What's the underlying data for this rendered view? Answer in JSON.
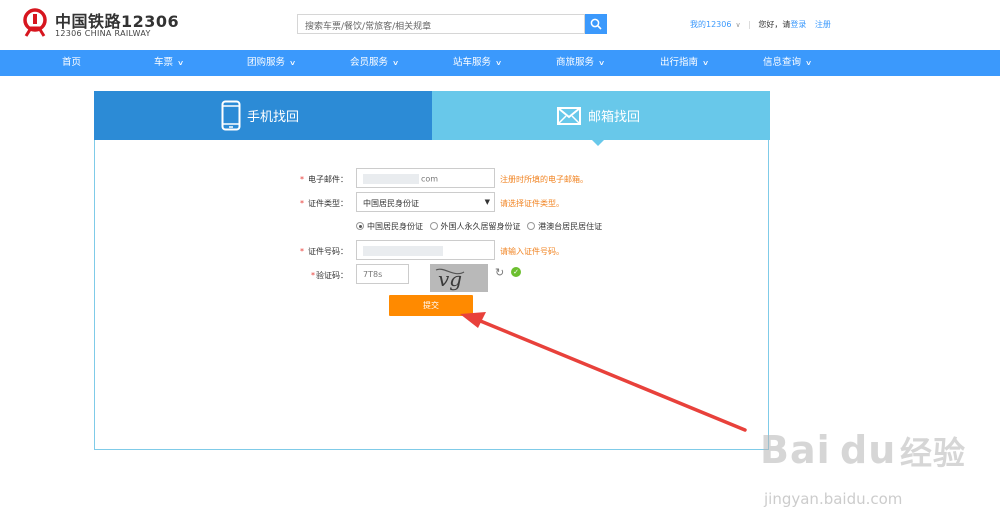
{
  "header": {
    "logo_title": "中国铁路12306",
    "logo_subtitle": "12306 CHINA RAILWAY",
    "search_placeholder": "搜索车票/餐饮/常旅客/相关规章",
    "my_account": "我的12306",
    "greeting": "您好，请",
    "login": "登录",
    "register": "注册"
  },
  "nav": {
    "items": [
      {
        "label": "首页",
        "dropdown": false
      },
      {
        "label": "车票",
        "dropdown": true
      },
      {
        "label": "团购服务",
        "dropdown": true
      },
      {
        "label": "会员服务",
        "dropdown": true
      },
      {
        "label": "站车服务",
        "dropdown": true
      },
      {
        "label": "商旅服务",
        "dropdown": true
      },
      {
        "label": "出行指南",
        "dropdown": true
      },
      {
        "label": "信息查询",
        "dropdown": true
      }
    ]
  },
  "tabs": {
    "phone": "手机找回",
    "email": "邮箱找回",
    "active": "email"
  },
  "form": {
    "email_label": "电子邮件：",
    "email_value_suffix": "com",
    "email_hint": "注册时所填的电子邮箱。",
    "id_type_label": "证件类型：",
    "id_type_value": "中国居民身份证",
    "id_type_hint": "请选择证件类型。",
    "radio_options": [
      "中国居民身份证",
      "外国人永久居留身份证",
      "港澳台居民居住证"
    ],
    "radio_selected": 0,
    "id_number_label": "证件号码：",
    "id_number_hint": "请输入证件号码。",
    "captcha_label": "验证码：",
    "captcha_value": "7T8s",
    "captcha_image_text": "vg",
    "submit": "提交"
  },
  "watermark": {
    "brand": "Bai",
    "brand_du": "du",
    "brand_cn": "经验",
    "url": "jingyan.baidu.com"
  },
  "colors": {
    "nav_blue": "#3b99fc",
    "tab_active": "#68c8ea",
    "tab_inactive": "#2c8bd6",
    "submit_orange": "#ff8a00",
    "hint_orange": "#f18423",
    "arrow_red": "#e8413b"
  }
}
